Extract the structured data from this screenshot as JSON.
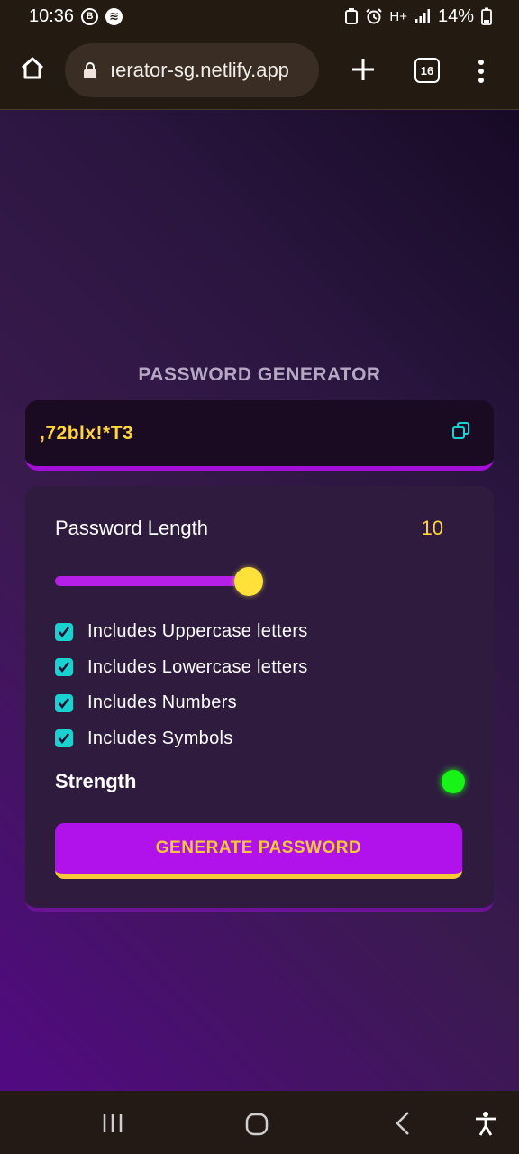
{
  "status_bar": {
    "time": "10:36",
    "battery": "14%",
    "network": "H+"
  },
  "browser": {
    "url": "ıerator-sg.netlify.app",
    "tab_count": "16"
  },
  "app": {
    "title": "PASSWORD GENERATOR",
    "password": ",72blx!*T3",
    "length_label": "Password Length",
    "length_value": "10",
    "options": [
      {
        "label": "Includes Uppercase letters",
        "checked": true
      },
      {
        "label": "Includes Lowercase letters",
        "checked": true
      },
      {
        "label": "Includes Numbers",
        "checked": true
      },
      {
        "label": "Includes Symbols",
        "checked": true
      }
    ],
    "strength_label": "Strength",
    "generate_label": "GENERATE PASSWORD"
  },
  "colors": {
    "accent": "#b112ec",
    "highlight": "#ffd43c",
    "checkbox": "#1ad1d1",
    "strength_strong": "#17f217"
  }
}
